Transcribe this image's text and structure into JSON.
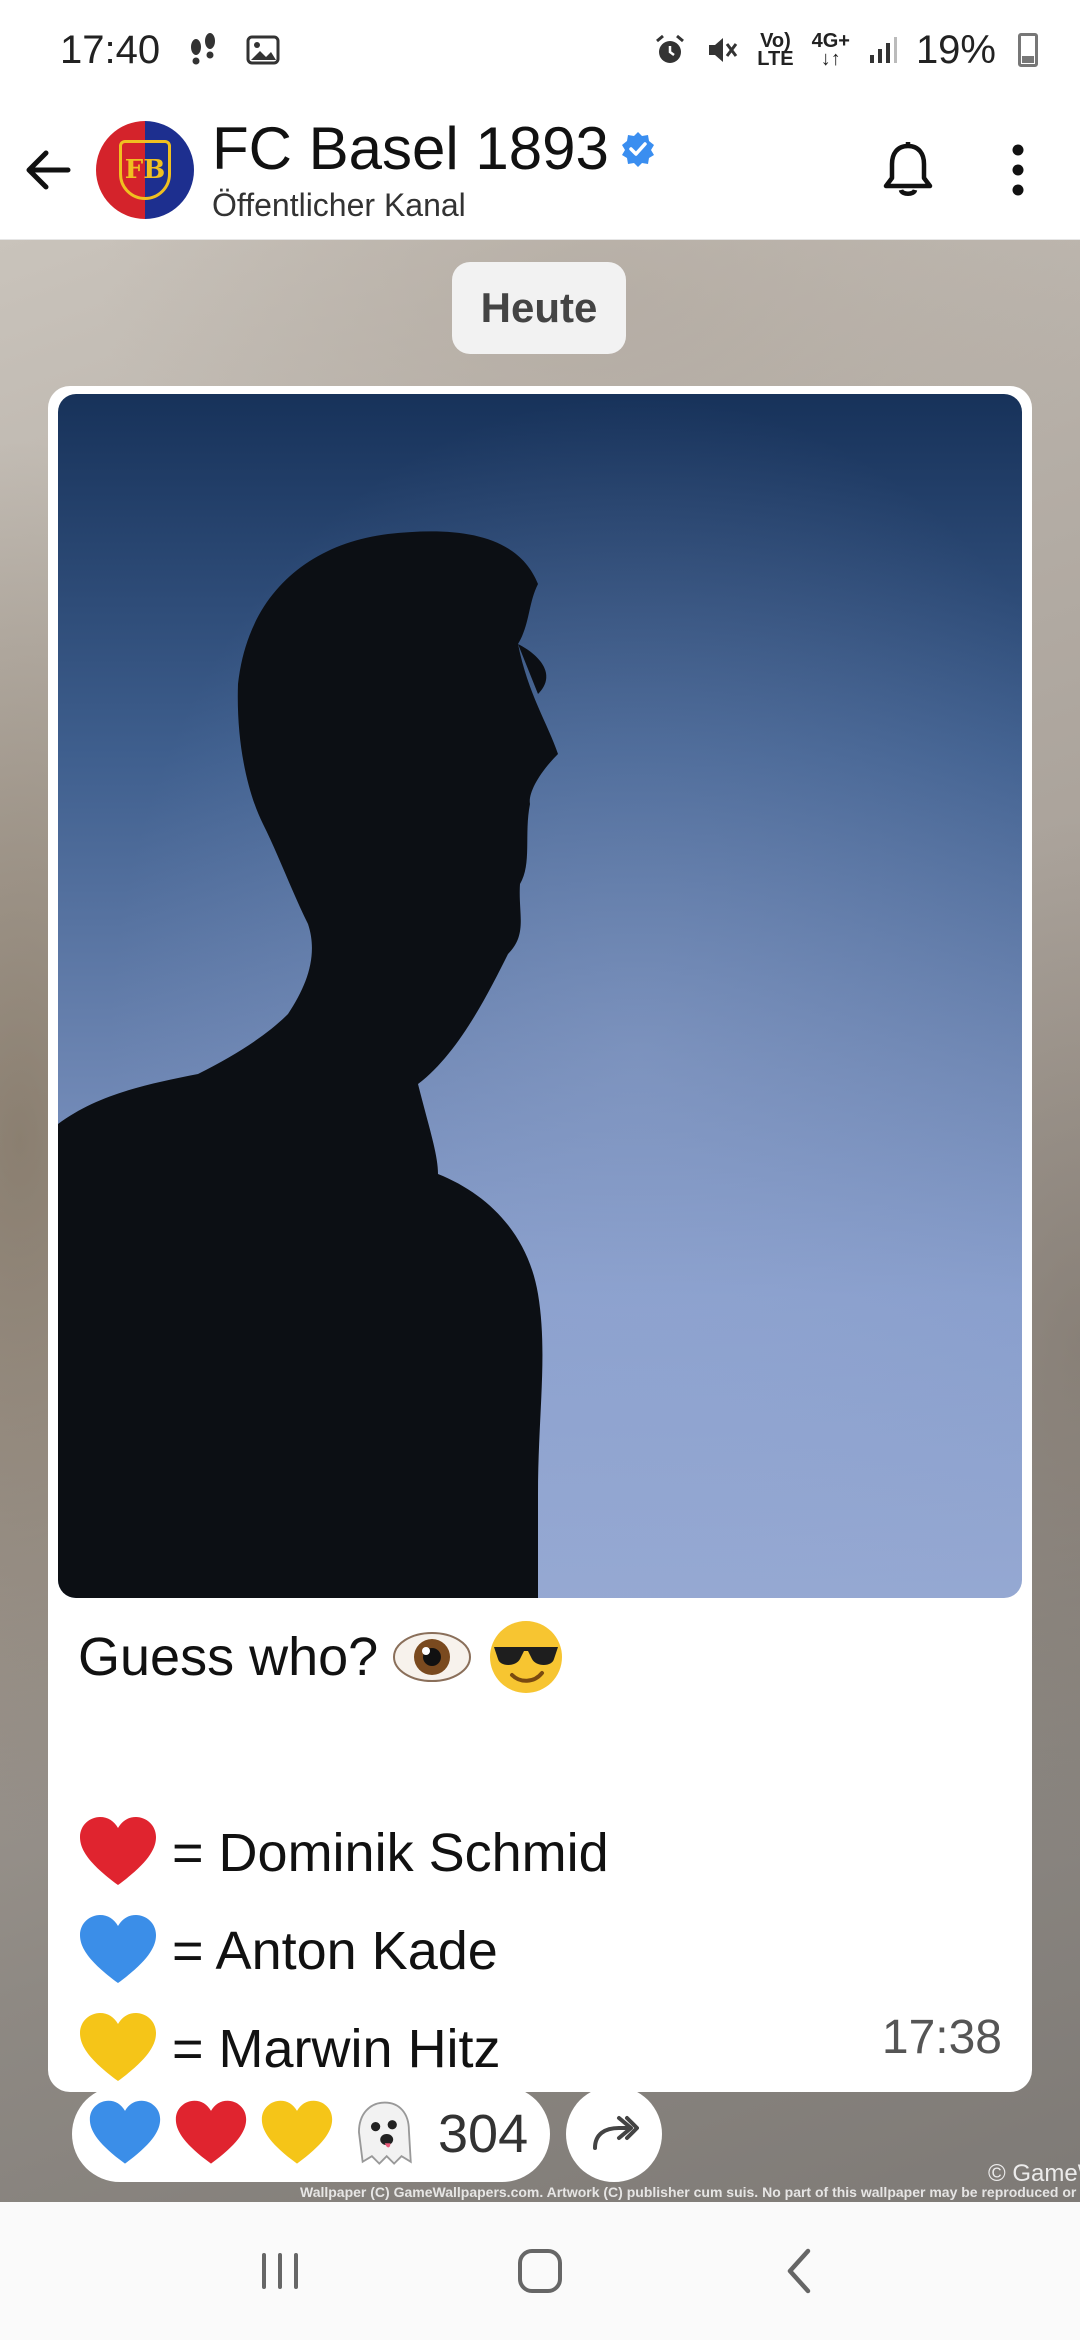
{
  "status_bar": {
    "time": "17:40",
    "volte": "Vo)",
    "lte": "LTE",
    "network": "4G+",
    "battery": "19%"
  },
  "header": {
    "channel_name": "FC Basel 1893",
    "subtitle": "Öffentlicher Kanal",
    "crest_letters": "FB",
    "verified": true
  },
  "chat": {
    "date_separator": "Heute",
    "message": {
      "lines": [
        "Guess who? 👁️😎",
        "",
        "= Dominik Schmid",
        "= Anton Kade",
        "= Marwin Hitz"
      ],
      "headline": "Guess who?",
      "options": [
        {
          "emoji": "red-heart",
          "text": "= Dominik Schmid"
        },
        {
          "emoji": "blue-heart",
          "text": "= Anton Kade"
        },
        {
          "emoji": "yellow-heart",
          "text": "= Marwin Hitz"
        }
      ],
      "time": "17:38"
    },
    "reactions": {
      "emojis": [
        "blue-heart",
        "red-heart",
        "yellow-heart",
        "ghost"
      ],
      "count": "304"
    },
    "watermark": "Wallpaper (C) GameWallpapers.com. Artwork (C) publisher cum suis. No part of this wallpaper may be reproduced or transmitted",
    "watermark_brand": "© GameW"
  },
  "colors": {
    "heart_red": "#e0242f",
    "heart_blue": "#3b8ee8",
    "heart_yellow": "#f5c518",
    "verified_blue": "#3a8ef0",
    "crest_red": "#d4232b",
    "crest_blue": "#1d2f8f"
  }
}
